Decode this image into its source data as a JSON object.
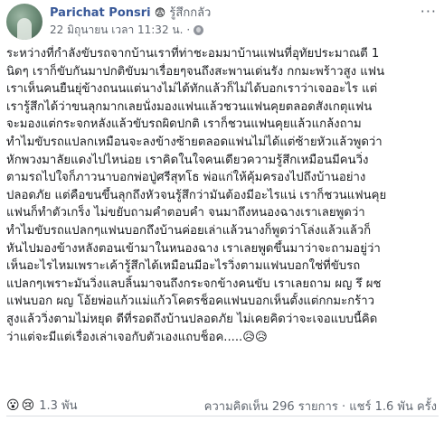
{
  "author": {
    "name": "Parichat Ponsri",
    "feeling_emoji": "😨",
    "feeling_text": "รู้สึกกลัว",
    "avatar_icon": "profile-photo"
  },
  "meta": {
    "timestamp": "22 มิถุนายน เวลา 11:32 น.",
    "separator": "·",
    "privacy_icon": "globe-icon"
  },
  "post": {
    "lines": [
      "ระหว่างที่กำลังขับรถจากบ้านเราที่ท่าชะอมมาบ้านแฟนที่อุทัยประมาณตี 1",
      "นิดๆ เราก็ขับกันมาปกติขับมาเรื่อยๆจนถึงสะพานเด่นรัง กกมะพร้าวสูง แฟน",
      "เราเห็นคนยืนยุ่ข้างถนนแต่นางไม่ได้ทักแล้วก็ไม่ได้บอกเราว่าเจออะไร แต่",
      "เรารู้สึกได้ว่าขนลุกมากเลยนั่งมองแฟนแล้วชวนแฟนคุยตลอดสังเกตุแฟน",
      "จะมองแต่กระจกหลังแล้วขับรถผิดปกติ เราก็ชวนแฟนคุยแล้วแกล้งถาม",
      "ทำไมขับรถแปลกเหมือนจะลงข้างซ้ายตลอดแฟนไม่ได้แต่ซ้ายหัวแล้วพูดว่า",
      "หักพวงมาลัยแดงไปไหน่อย เราคิดในใจคนเดียวความรู้สึกเหมือนมีคนวิ่ง",
      "ตามรถไปใจก็ภาวนาบอกพ่อปู่ศรีสุทโธ พ่อแก่ให้คุ้มครองไปถึงบ้านอย่าง",
      "ปลอดภัย แต่คือขนขึ้นลุกถึงหัวจนรู้สึกว่ามันต้องมีอะไรแน่ เราก็ชวนแฟนคุย",
      "แฟนก็ทำตัวเกร็ง ไม่ขยับถามคำตอบคำ จนมาถึงหนองฉางเราเลยพูดว่า",
      "ทำไมขับรถแปลกๆแฟนบอกถึงบ้านค่อยเล่าแล้วนางก็พูดว่าโล่งแล้วแล้วก็",
      "หันไปมองข้างหลังตอนเข้ามาในหนองฉาง เราเลยพูดขึ้นมาว่าจะถามอยู่ว่า",
      "เห็นอะไรไหมเพราะเค้ารู้สึกได้เหมือนมีอะไรวิ่งตามแฟนบอกใช่ที่ขับรถ",
      "แปลกๆเพราะมันวิ่งแลบลิ้นมาจนถึงกระจกข้างคนขับ เราเลยถาม ผญ รึ ผช",
      "แฟนบอก ผญ โอ้ยพ่อแก้วแม่แก้วโคตรช็อคแฟนบอกเห็นตั้งแต่กกมะกร้าว",
      "สูงแล้ววิ่งตามไม่หยุด ดีที่รอดถึงบ้านปลอดภัย ไม่เคยคิดว่าจะเจอแบบนี้คิด",
      "ว่าแต่จะมีแต่เรื่องเล่าเจอกับตัวเองแถบช็อค.....😥😥"
    ]
  },
  "reactions": {
    "icons": [
      "😮",
      "😢"
    ],
    "icon_names": [
      "wow-reaction-icon",
      "sad-reaction-icon"
    ],
    "count": "1.3 พัน"
  },
  "stats": {
    "comments": "ความคิดเห็น 296 รายการ",
    "separator": "·",
    "shares": "แชร์ 1.6 พัน ครั้ง"
  },
  "colors": {
    "author_link": "#385898",
    "meta_text": "#616770",
    "body_text": "#1c1e21"
  }
}
